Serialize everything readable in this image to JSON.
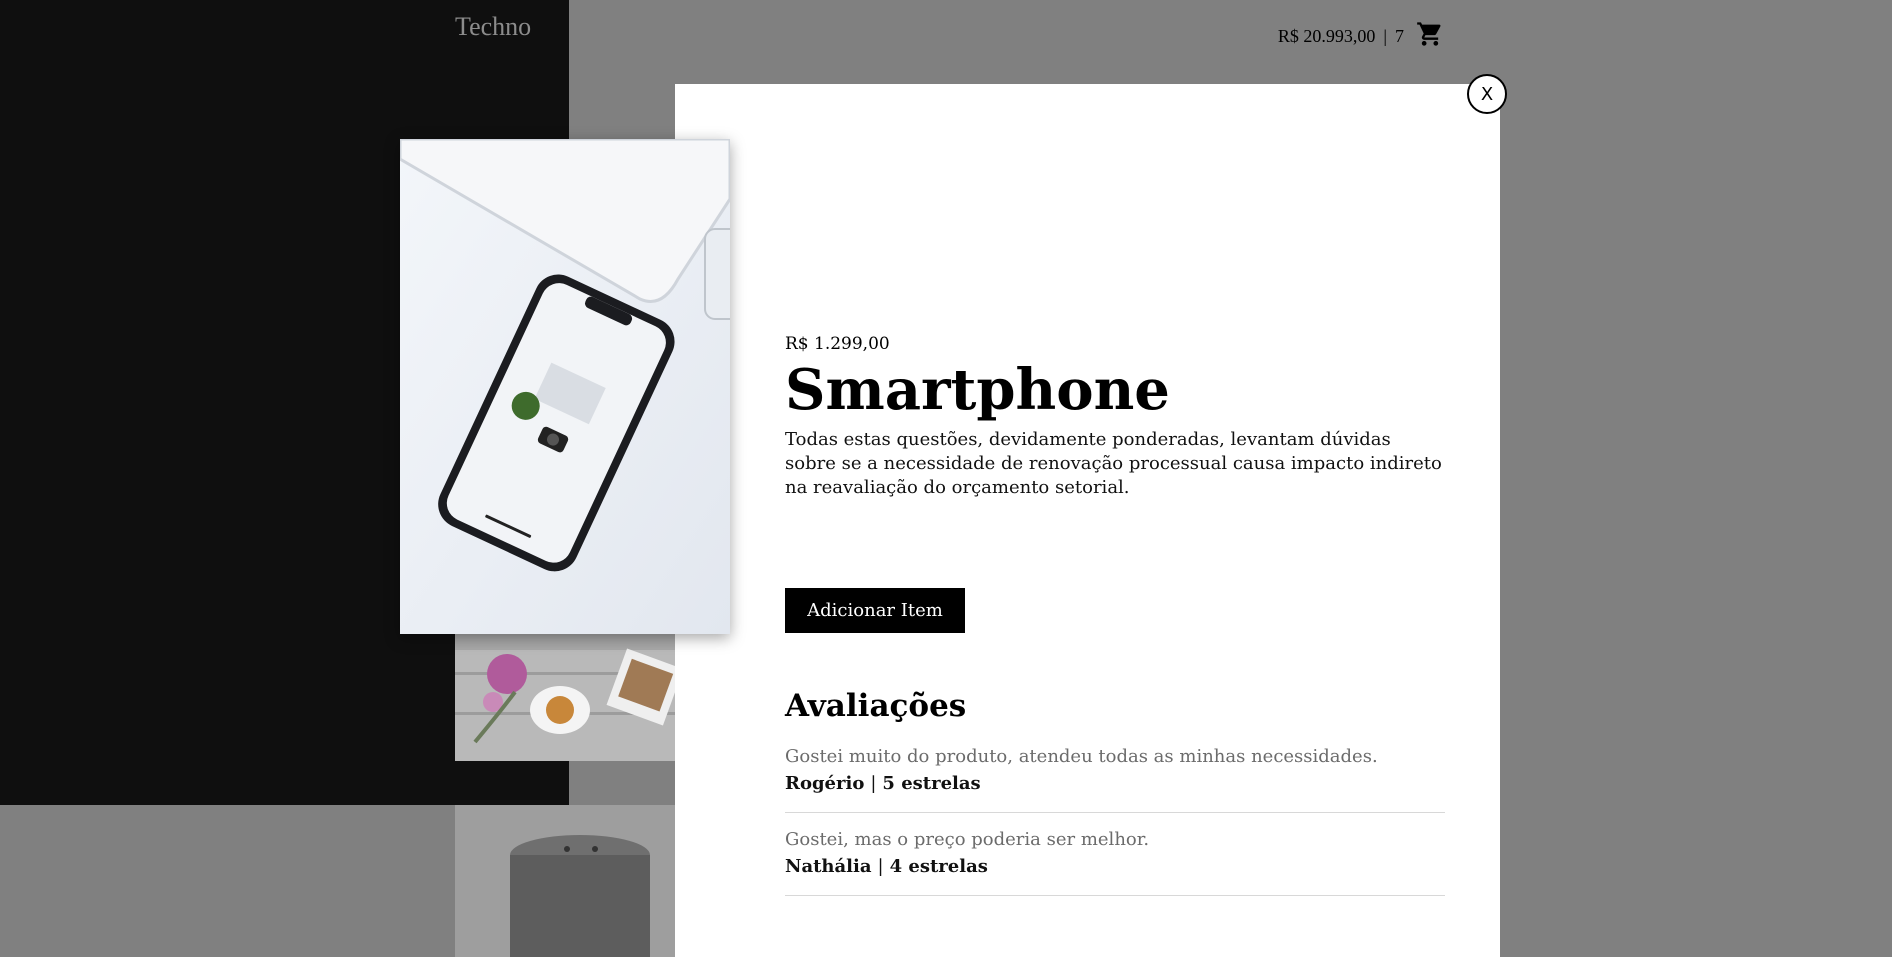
{
  "header": {
    "logo": "Techno",
    "cart_total": "R$ 20.993,00",
    "cart_separator": "|",
    "cart_count": "7",
    "cart_icon": "cart-icon"
  },
  "modal": {
    "close_label": "X",
    "product": {
      "price": "R$ 1.299,00",
      "name": "Smartphone",
      "description": "Todas estas questões, devidamente ponderadas, levantam dúvidas sobre se a necessidade de renovação processual causa impacto indireto na reavaliação do orçamento setorial.",
      "add_button": "Adicionar Item"
    },
    "reviews": {
      "heading": "Avaliações",
      "items": [
        {
          "text": "Gostei muito do produto, atendeu todas as minhas necessidades.",
          "author": "Rogério",
          "separator": "|",
          "rating": "5 estrelas"
        },
        {
          "text": "Gostei, mas o preço poderia ser melhor.",
          "author": "Nathália",
          "separator": "|",
          "rating": "4 estrelas"
        }
      ]
    }
  },
  "colors": {
    "overlay": "#808080",
    "sidebar": "#0f0f0f",
    "button": "#000000",
    "review_text": "#6b6b6b"
  }
}
